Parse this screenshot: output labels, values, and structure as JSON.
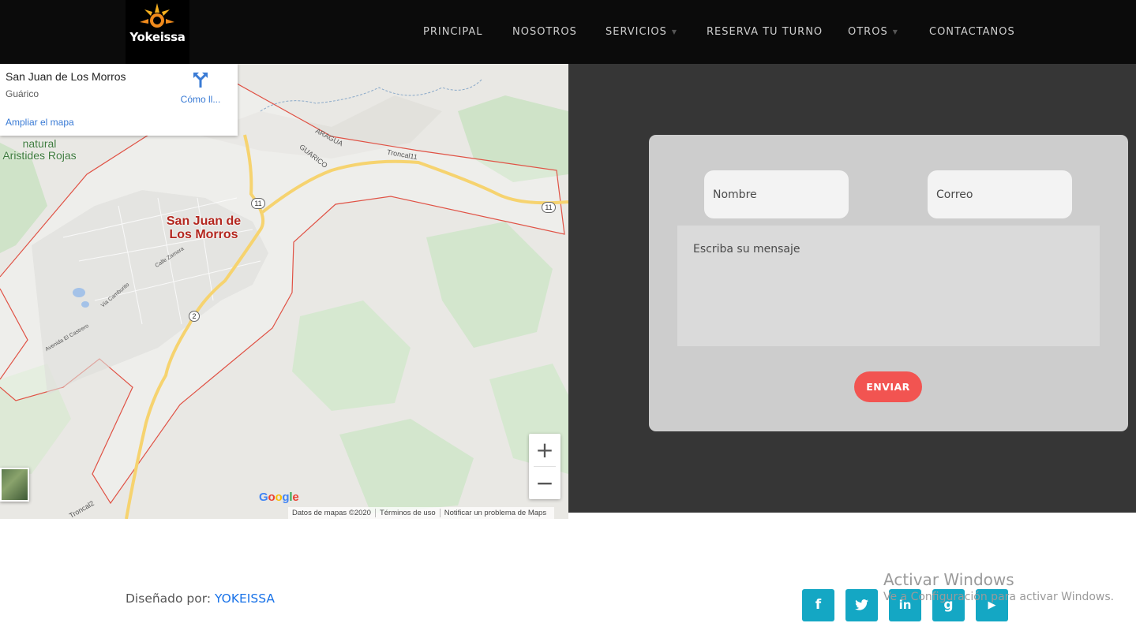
{
  "brand": {
    "name": "Yokeissa"
  },
  "nav": {
    "items": [
      {
        "label": "PRINCIPAL"
      },
      {
        "label": "NOSOTROS"
      },
      {
        "label": "SERVICIOS",
        "has_dropdown": true
      },
      {
        "label": "RESERVA TU TURNO"
      },
      {
        "label": "OTROS",
        "has_dropdown": true
      },
      {
        "label": "CONTACTANOS"
      }
    ]
  },
  "map": {
    "place_title": "San Juan de Los Morros",
    "place_subtitle": "Guárico",
    "directions_label": "Cómo ll...",
    "enlarge_link": "Ampliar el mapa",
    "city_label_line1": "San Juan de",
    "city_label_line2": "Los Morros",
    "park_label_line1": "natural",
    "park_label_line2": "Aristides Rojas",
    "labels": {
      "aragua": "ARAGUA",
      "guarico": "GUARICO",
      "troncal11": "Troncal11",
      "troncal2": "Troncal2",
      "calle_zamora": "Calle Zamora",
      "via_camburito": "Via Camburito",
      "avenida_castrero": "Avenida El Castrero"
    },
    "shields": {
      "route11": "11",
      "route11b": "11",
      "route2": "2"
    },
    "zoom_in": "+",
    "zoom_out": "−",
    "google": "Google",
    "attribution": [
      "Datos de mapas ©2020",
      "Términos de uso",
      "Notificar un problema de Maps"
    ],
    "icons": [
      "directions-icon",
      "satellite-layer-icon"
    ]
  },
  "contact": {
    "name_placeholder": "Nombre",
    "email_placeholder": "Correo",
    "message_placeholder": "Escriba su mensaje",
    "send_label": "ENVIAR"
  },
  "footer": {
    "designed_by_prefix": "Diseñado por: ",
    "designed_by_name": "YOKEISSA",
    "social": [
      {
        "icon": "facebook-icon",
        "glyph": "f"
      },
      {
        "icon": "twitter-icon",
        "glyph": "t"
      },
      {
        "icon": "linkedin-icon",
        "glyph": "in"
      },
      {
        "icon": "google-plus-icon",
        "glyph": "g"
      },
      {
        "icon": "youtube-icon",
        "glyph": "▶"
      }
    ]
  },
  "watermark": {
    "title": "Activar Windows",
    "subtitle": "Ve a Configuración para activar Windows."
  },
  "colors": {
    "navbar": "#0b0b0b",
    "accent_send": "#f25451",
    "social": "#14a7c4",
    "contact_bg": "#363636",
    "card": "#cdcdcd",
    "link": "#1a73e8"
  }
}
